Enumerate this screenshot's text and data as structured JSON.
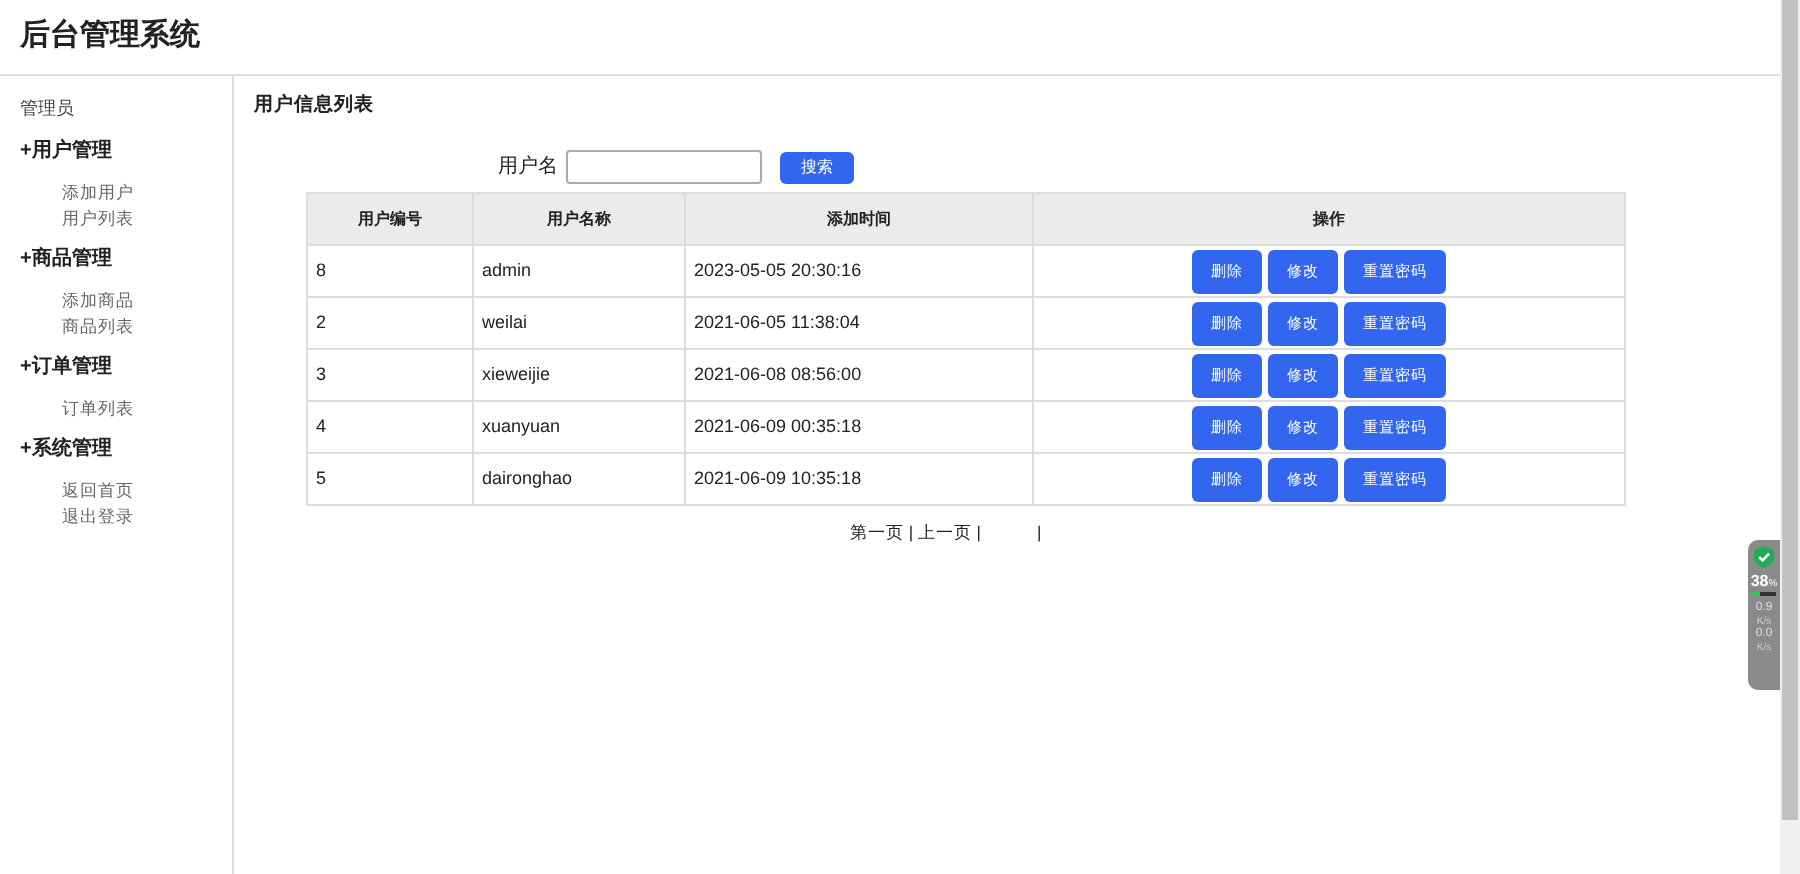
{
  "header": {
    "title": "后台管理系统"
  },
  "sidebar": {
    "role": "管理员",
    "groups": [
      {
        "title": "+用户管理",
        "items": [
          "添加用户",
          "用户列表"
        ]
      },
      {
        "title": "+商品管理",
        "items": [
          "添加商品",
          "商品列表"
        ]
      },
      {
        "title": "+订单管理",
        "items": [
          "订单列表"
        ]
      },
      {
        "title": "+系统管理",
        "items": [
          "返回首页",
          "退出登录"
        ]
      }
    ]
  },
  "main": {
    "title": "用户信息列表",
    "search": {
      "label": "用户名",
      "button": "搜索"
    },
    "table": {
      "columns": [
        "用户编号",
        "用户名称",
        "添加时间",
        "操作"
      ],
      "rows": [
        {
          "id": "8",
          "name": "admin",
          "time": "2023-05-05 20:30:16",
          "actions": [
            "删除",
            "修改",
            "重置密码"
          ]
        },
        {
          "id": "2",
          "name": "weilai",
          "time": "2021-06-05 11:38:04",
          "actions": [
            "删除",
            "修改",
            "重置密码"
          ]
        },
        {
          "id": "3",
          "name": "xieweijie",
          "time": "2021-06-08 08:56:00",
          "actions": [
            "删除",
            "修改",
            "重置密码"
          ]
        },
        {
          "id": "4",
          "name": "xuanyuan",
          "time": "2021-06-09 00:35:18",
          "actions": [
            "删除",
            "修改",
            "重置密码"
          ]
        },
        {
          "id": "5",
          "name": "daironghao",
          "time": "2021-06-09 10:35:18",
          "actions": [
            "删除",
            "修改",
            "重置密码"
          ]
        }
      ]
    },
    "pagination": [
      "第一页 | 上一页 |",
      "|"
    ]
  },
  "monitor": {
    "cpu": "38",
    "unit": "%",
    "level": 0.35,
    "up": "0.9",
    "up_unit": "K/s",
    "down": "0.0",
    "down_unit": "K/s"
  }
}
